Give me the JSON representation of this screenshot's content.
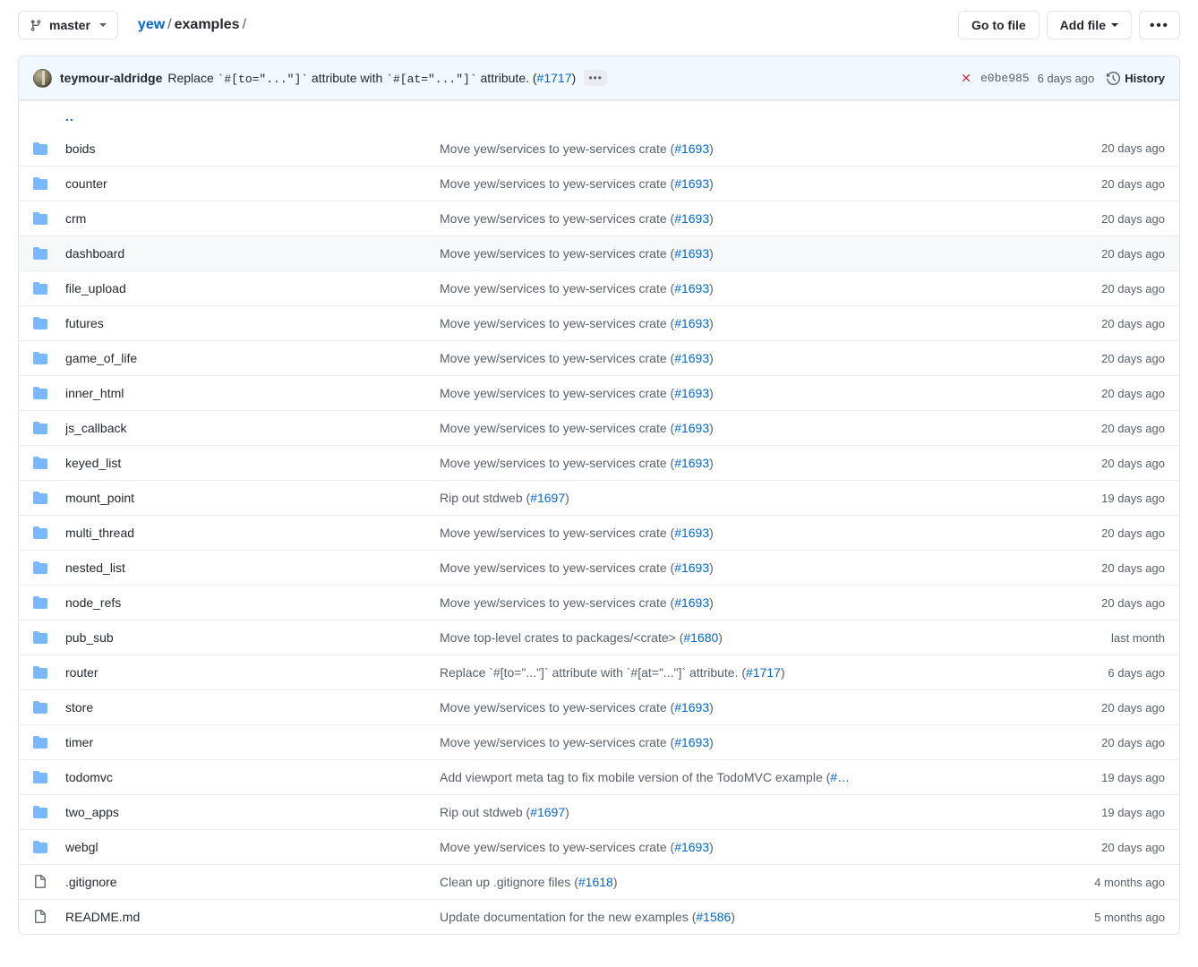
{
  "toolbar": {
    "branch": {
      "label": "master",
      "icon": "branch-icon"
    },
    "breadcrumb": {
      "repo": "yew",
      "sep1": "/",
      "dir": "examples",
      "sep2": "/"
    },
    "go_to_file": "Go to file",
    "add_file": "Add file",
    "more_label": "•••"
  },
  "commit_header": {
    "author": "teymour-aldridge",
    "message_prefix": "Replace ",
    "code1": "`#[to=\"...\"]`",
    "message_mid": " attribute with ",
    "code2": "`#[at=\"...\"]`",
    "message_suffix": " attribute. (",
    "pr": "#1717",
    "message_close": ")",
    "expand": "•••",
    "status_icon": "x-failed-icon",
    "sha": "e0be985",
    "age": "6 days ago",
    "history": "History",
    "history_icon": "clock-icon",
    "background": "#f1f8ff"
  },
  "updir": {
    "label": ".."
  },
  "colors": {
    "folder": "#79b8ff",
    "file": "#6a737d",
    "link": "#0366d6",
    "failed": "#cb2431",
    "hover_row": "#f6f8fa"
  },
  "rows": [
    {
      "type": "folder",
      "name": "boids",
      "msg_pre": "Move yew/services to yew-services crate (",
      "pr": "#1693",
      "msg_post": ")",
      "age": "20 days ago",
      "hover": false
    },
    {
      "type": "folder",
      "name": "counter",
      "msg_pre": "Move yew/services to yew-services crate (",
      "pr": "#1693",
      "msg_post": ")",
      "age": "20 days ago",
      "hover": false
    },
    {
      "type": "folder",
      "name": "crm",
      "msg_pre": "Move yew/services to yew-services crate (",
      "pr": "#1693",
      "msg_post": ")",
      "age": "20 days ago",
      "hover": false
    },
    {
      "type": "folder",
      "name": "dashboard",
      "msg_pre": "Move yew/services to yew-services crate (",
      "pr": "#1693",
      "msg_post": ")",
      "age": "20 days ago",
      "hover": true
    },
    {
      "type": "folder",
      "name": "file_upload",
      "msg_pre": "Move yew/services to yew-services crate (",
      "pr": "#1693",
      "msg_post": ")",
      "age": "20 days ago",
      "hover": false
    },
    {
      "type": "folder",
      "name": "futures",
      "msg_pre": "Move yew/services to yew-services crate (",
      "pr": "#1693",
      "msg_post": ")",
      "age": "20 days ago",
      "hover": false
    },
    {
      "type": "folder",
      "name": "game_of_life",
      "msg_pre": "Move yew/services to yew-services crate (",
      "pr": "#1693",
      "msg_post": ")",
      "age": "20 days ago",
      "hover": false
    },
    {
      "type": "folder",
      "name": "inner_html",
      "msg_pre": "Move yew/services to yew-services crate (",
      "pr": "#1693",
      "msg_post": ")",
      "age": "20 days ago",
      "hover": false
    },
    {
      "type": "folder",
      "name": "js_callback",
      "msg_pre": "Move yew/services to yew-services crate (",
      "pr": "#1693",
      "msg_post": ")",
      "age": "20 days ago",
      "hover": false
    },
    {
      "type": "folder",
      "name": "keyed_list",
      "msg_pre": "Move yew/services to yew-services crate (",
      "pr": "#1693",
      "msg_post": ")",
      "age": "20 days ago",
      "hover": false
    },
    {
      "type": "folder",
      "name": "mount_point",
      "msg_pre": "Rip out stdweb (",
      "pr": "#1697",
      "msg_post": ")",
      "age": "19 days ago",
      "hover": false
    },
    {
      "type": "folder",
      "name": "multi_thread",
      "msg_pre": "Move yew/services to yew-services crate (",
      "pr": "#1693",
      "msg_post": ")",
      "age": "20 days ago",
      "hover": false
    },
    {
      "type": "folder",
      "name": "nested_list",
      "msg_pre": "Move yew/services to yew-services crate (",
      "pr": "#1693",
      "msg_post": ")",
      "age": "20 days ago",
      "hover": false
    },
    {
      "type": "folder",
      "name": "node_refs",
      "msg_pre": "Move yew/services to yew-services crate (",
      "pr": "#1693",
      "msg_post": ")",
      "age": "20 days ago",
      "hover": false
    },
    {
      "type": "folder",
      "name": "pub_sub",
      "msg_pre": "Move top-level crates to packages/<crate> (",
      "pr": "#1680",
      "msg_post": ")",
      "age": "last month",
      "hover": false
    },
    {
      "type": "folder",
      "name": "router",
      "msg_pre": "Replace `#[to=\"...\"]` attribute with `#[at=\"...\"]` attribute. (",
      "pr": "#1717",
      "msg_post": ")",
      "age": "6 days ago",
      "hover": false
    },
    {
      "type": "folder",
      "name": "store",
      "msg_pre": "Move yew/services to yew-services crate (",
      "pr": "#1693",
      "msg_post": ")",
      "age": "20 days ago",
      "hover": false
    },
    {
      "type": "folder",
      "name": "timer",
      "msg_pre": "Move yew/services to yew-services crate (",
      "pr": "#1693",
      "msg_post": ")",
      "age": "20 days ago",
      "hover": false
    },
    {
      "type": "folder",
      "name": "todomvc",
      "msg_pre": "Add viewport meta tag to fix mobile version of the TodoMVC example (",
      "pr": "#…",
      "msg_post": "",
      "age": "19 days ago",
      "hover": false
    },
    {
      "type": "folder",
      "name": "two_apps",
      "msg_pre": "Rip out stdweb (",
      "pr": "#1697",
      "msg_post": ")",
      "age": "19 days ago",
      "hover": false
    },
    {
      "type": "folder",
      "name": "webgl",
      "msg_pre": "Move yew/services to yew-services crate (",
      "pr": "#1693",
      "msg_post": ")",
      "age": "20 days ago",
      "hover": false
    },
    {
      "type": "file",
      "name": ".gitignore",
      "msg_pre": "Clean up .gitignore files (",
      "pr": "#1618",
      "msg_post": ")",
      "age": "4 months ago",
      "hover": false
    },
    {
      "type": "file",
      "name": "README.md",
      "msg_pre": "Update documentation for the new examples (",
      "pr": "#1586",
      "msg_post": ")",
      "age": "5 months ago",
      "hover": false
    }
  ]
}
